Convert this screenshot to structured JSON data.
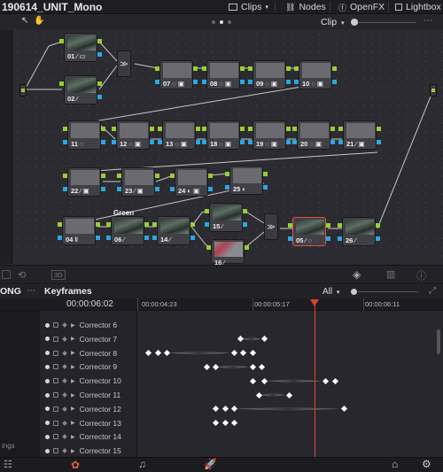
{
  "project_title": "190614_UNIT_Mono",
  "top_toolbar": {
    "clips_label": "Clips",
    "nodes_label": "Nodes",
    "openfx_label": "OpenFX",
    "lightbox_label": "Lightbox",
    "clip_mode": "Clip"
  },
  "nodes": [
    {
      "id": "01",
      "icons": "∕ ▭",
      "thumb": "img"
    },
    {
      "id": "02",
      "icons": "∕",
      "thumb": "img"
    },
    {
      "id": "07",
      "icons": "◌ ▣",
      "thumb": "plain"
    },
    {
      "id": "08",
      "icons": "◌ ▣",
      "thumb": "plain"
    },
    {
      "id": "09",
      "icons": "◌ ▣",
      "thumb": "plain"
    },
    {
      "id": "10",
      "icons": "◌ ▣",
      "thumb": "plain"
    },
    {
      "id": "11",
      "icons": "◌",
      "thumb": "plain"
    },
    {
      "id": "12",
      "icons": "◌ ▣",
      "thumb": "plain"
    },
    {
      "id": "13",
      "icons": "◌ ▣",
      "thumb": "plain"
    },
    {
      "id": "18",
      "icons": "◌ ▣",
      "thumb": "plain"
    },
    {
      "id": "19",
      "icons": "◌ ▣",
      "thumb": "plain"
    },
    {
      "id": "20",
      "icons": "◌ ▣",
      "thumb": "plain"
    },
    {
      "id": "21",
      "icons": "∕ ▣",
      "thumb": "plain"
    },
    {
      "id": "22",
      "icons": "∕ ▣",
      "thumb": "plain"
    },
    {
      "id": "23",
      "icons": "∕ ▣",
      "thumb": "plain"
    },
    {
      "id": "24",
      "icons": "◐ ▣",
      "thumb": "plain"
    },
    {
      "id": "25",
      "icons": "◐",
      "thumb": "plain"
    },
    {
      "id": "04",
      "icons": "Ⅱ",
      "thumb": "plain"
    },
    {
      "id": "06",
      "icons": "∕",
      "thumb": "img"
    },
    {
      "id": "14",
      "icons": "∕",
      "thumb": "img"
    },
    {
      "id": "15",
      "icons": "∕",
      "thumb": "img"
    },
    {
      "id": "16",
      "icons": "∕",
      "thumb": "img"
    },
    {
      "id": "05",
      "icons": "∕ ◌",
      "thumb": "img",
      "selected": true
    },
    {
      "id": "26",
      "icons": "∕",
      "thumb": "img"
    }
  ],
  "green_label": "Green",
  "keyframes": {
    "panel_left_label": "ONG",
    "title": "Keyframes",
    "filter": "All",
    "current_timecode": "00:00:06:02",
    "ruler_labels": [
      "00:00:04:23",
      "00:00:05:17",
      "00:00:06:11"
    ],
    "left_edge_label": "ings",
    "rows": [
      {
        "name": "Corrector 6",
        "keys": []
      },
      {
        "name": "Corrector 7",
        "keys": [
          0.33,
          0.41
        ]
      },
      {
        "name": "Corrector 8",
        "keys": [
          0.03,
          0.06,
          0.09,
          0.31,
          0.34,
          0.37
        ]
      },
      {
        "name": "Corrector 9",
        "keys": [
          0.22,
          0.25,
          0.37,
          0.4
        ]
      },
      {
        "name": "Corrector 10",
        "keys": [
          0.37,
          0.41,
          0.61,
          0.64
        ]
      },
      {
        "name": "Corrector 11",
        "keys": [
          0.39,
          0.49
        ]
      },
      {
        "name": "Corrector 12",
        "keys": [
          0.25,
          0.28,
          0.31,
          0.67
        ]
      },
      {
        "name": "Corrector 13",
        "keys": [
          0.25,
          0.28,
          0.31
        ]
      },
      {
        "name": "Corrector 14",
        "keys": []
      },
      {
        "name": "Corrector 15",
        "keys": []
      }
    ]
  }
}
